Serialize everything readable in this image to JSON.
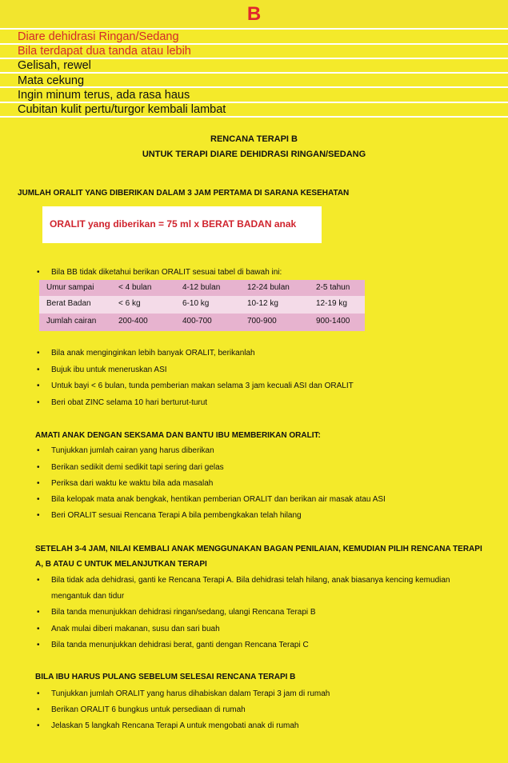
{
  "header": {
    "letter": "B"
  },
  "signs": {
    "title": "Diare dehidrasi Ringan/Sedang",
    "subtitle": "Bila terdapat dua tanda atau lebih",
    "items": [
      "Gelisah, rewel",
      "Mata cekung",
      "Ingin minum terus, ada rasa haus",
      "Cubitan kulit pertu/turgor kembali lambat"
    ]
  },
  "plan": {
    "title": "RENCANA TERAPI B",
    "subtitle": "UNTUK TERAPI DIARE DEHIDRASI RINGAN/SEDANG"
  },
  "oralit": {
    "heading": "JUMLAH ORALIT YANG DIBERIKAN DALAM 3 JAM PERTAMA DI SARANA KESEHATAN",
    "formula": "ORALIT yang diberikan =  75 ml x BERAT BADAN anak",
    "bb_note": "Bila BB tidak diketahui berikan ORALIT sesuai tabel di bawah ini:",
    "table": [
      [
        "Umur sampai",
        "< 4 bulan",
        "4-12 bulan",
        "12-24 bulan",
        "2-5 tahun"
      ],
      [
        "Berat Badan",
        "< 6 kg",
        "6-10 kg",
        "10-12 kg",
        "12-19 kg"
      ],
      [
        "Jumlah cairan",
        "200-400",
        "400-700",
        "700-900",
        "900-1400"
      ]
    ],
    "bullets": [
      "Bila anak menginginkan lebih banyak ORALIT, berikanlah",
      "Bujuk ibu untuk meneruskan ASI",
      "Untuk bayi < 6 bulan, tunda pemberian makan selama 3  jam kecuali ASI dan ORALIT",
      "Beri obat ZINC selama 10 hari berturut-turut"
    ]
  },
  "observe": {
    "heading": "AMATI ANAK DENGAN SEKSAMA DAN BANTU IBU MEMBERIKAN ORALIT:",
    "bullets": [
      "Tunjukkan jumlah cairan yang harus diberikan",
      "Berikan sedikit demi sedikit tapi sering dari gelas",
      "Periksa dari waktu ke waktu bila ada masalah",
      "Bila kelopak mata anak bengkak, hentikan pemberian ORALIT dan berikan air masak atau ASI",
      "Beri ORALIT sesuai Rencana Terapi A bila pembengkakan telah hilang"
    ]
  },
  "after": {
    "heading_line1": "SETELAH 3-4 JAM, NILAI KEMBALI ANAK MENGGUNAKAN BAGAN PENILAIAN, KEMUDIAN PILIH RENCANA TERAPI",
    "heading_line2": "A, B ATAU C UNTUK MELANJUTKAN TERAPI",
    "bullet1_line1": "Bila tidak ada dehidrasi, ganti ke Rencana Terapi A. Bila dehidrasi telah hilang, anak biasanya kencing kemudian",
    "bullet1_line2": "mengantuk dan tidur",
    "bullets": [
      "Bila tanda menunjukkan dehidrasi ringan/sedang, ulangi Rencana Terapi B",
      "Anak mulai diberi makanan, susu dan sari buah",
      "Bila tanda menunjukkan dehidrasi berat, ganti dengan Rencana Terapi C"
    ]
  },
  "home": {
    "heading": "BILA IBU HARUS PULANG SEBELUM SELESAI RENCANA TERAPI B",
    "bullets": [
      "Tunjukkan jumlah ORALIT yang harus dihabiskan dalam Terapi 3  jam di rumah",
      "Berikan ORALIT 6 bungkus untuk persediaan di rumah",
      "Jelaskan 5 langkah Rencana Terapi A untuk mengobati anak di rumah"
    ]
  },
  "bullet_symbol": "•",
  "colors": {
    "background": "#f4ea2a",
    "accent_red": "#d42a2a",
    "table_dark": "#e7b3cf",
    "table_light": "#f4dbe8"
  }
}
